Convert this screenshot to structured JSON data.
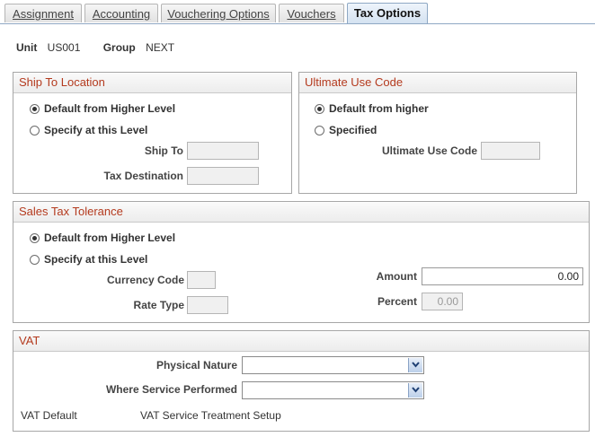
{
  "tabs": [
    {
      "label": "Assignment"
    },
    {
      "label": "Accounting"
    },
    {
      "label": "Vouchering Options"
    },
    {
      "label": "Vouchers"
    },
    {
      "label": "Tax Options"
    }
  ],
  "unit": {
    "label": "Unit",
    "value": "US001"
  },
  "group": {
    "label": "Group",
    "value": "NEXT"
  },
  "ship_to_location": {
    "title": "Ship To Location",
    "default_option": "Default from Higher Level",
    "specify_option": "Specify at this Level",
    "selected": "default",
    "ship_to_label": "Ship To",
    "ship_to_value": "",
    "tax_destination_label": "Tax Destination",
    "tax_destination_value": ""
  },
  "ultimate_use": {
    "title": "Ultimate Use Code",
    "default_option": "Default from higher",
    "specified_option": "Specified",
    "selected": "default",
    "code_label": "Ultimate Use Code",
    "code_value": ""
  },
  "sales_tax": {
    "title": "Sales Tax Tolerance",
    "default_option": "Default from Higher Level",
    "specify_option": "Specify at this Level",
    "selected": "default",
    "currency_label": "Currency Code",
    "currency_value": "",
    "rate_type_label": "Rate Type",
    "rate_type_value": "",
    "amount_label": "Amount",
    "amount_value": "0.00",
    "percent_label": "Percent",
    "percent_value": "0.00"
  },
  "vat": {
    "title": "VAT",
    "physical_nature_label": "Physical Nature",
    "physical_nature_value": "",
    "where_service_label": "Where Service Performed",
    "where_service_value": "",
    "vat_default_link": "VAT Default",
    "vat_service_link": "VAT Service Treatment Setup"
  },
  "colors": {
    "section_title": "#b43a1e",
    "tab_active": "#d4e2f1"
  }
}
